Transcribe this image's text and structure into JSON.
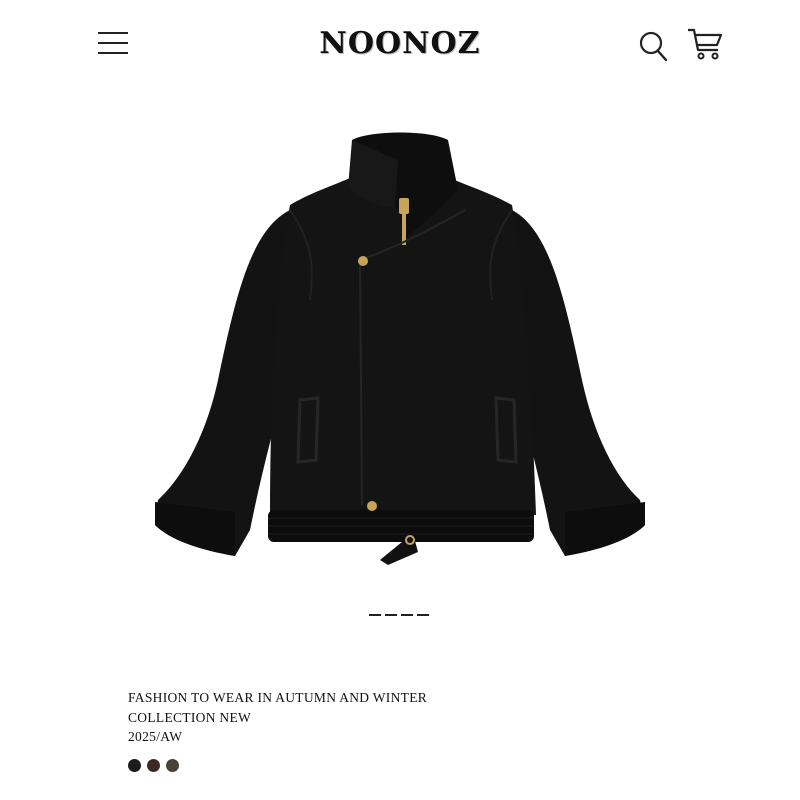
{
  "header": {
    "brand": "NOONOZ",
    "icons": [
      "menu-icon",
      "search-icon",
      "cart-icon"
    ]
  },
  "product": {
    "image_icon": "jacket-image",
    "carousel_pages": 4,
    "title_line1": "FASHION TO WEAR IN AUTUMN AND WINTER",
    "title_line2": "COLLECTION NEW",
    "season": "2025/AW",
    "swatch_colors": [
      "#1c1c1c",
      "#3b2a24",
      "#4a4236"
    ]
  },
  "colors": {
    "text": "#111111",
    "background": "#ffffff",
    "jacket": "#111111",
    "hardware": "#c8a35a"
  }
}
